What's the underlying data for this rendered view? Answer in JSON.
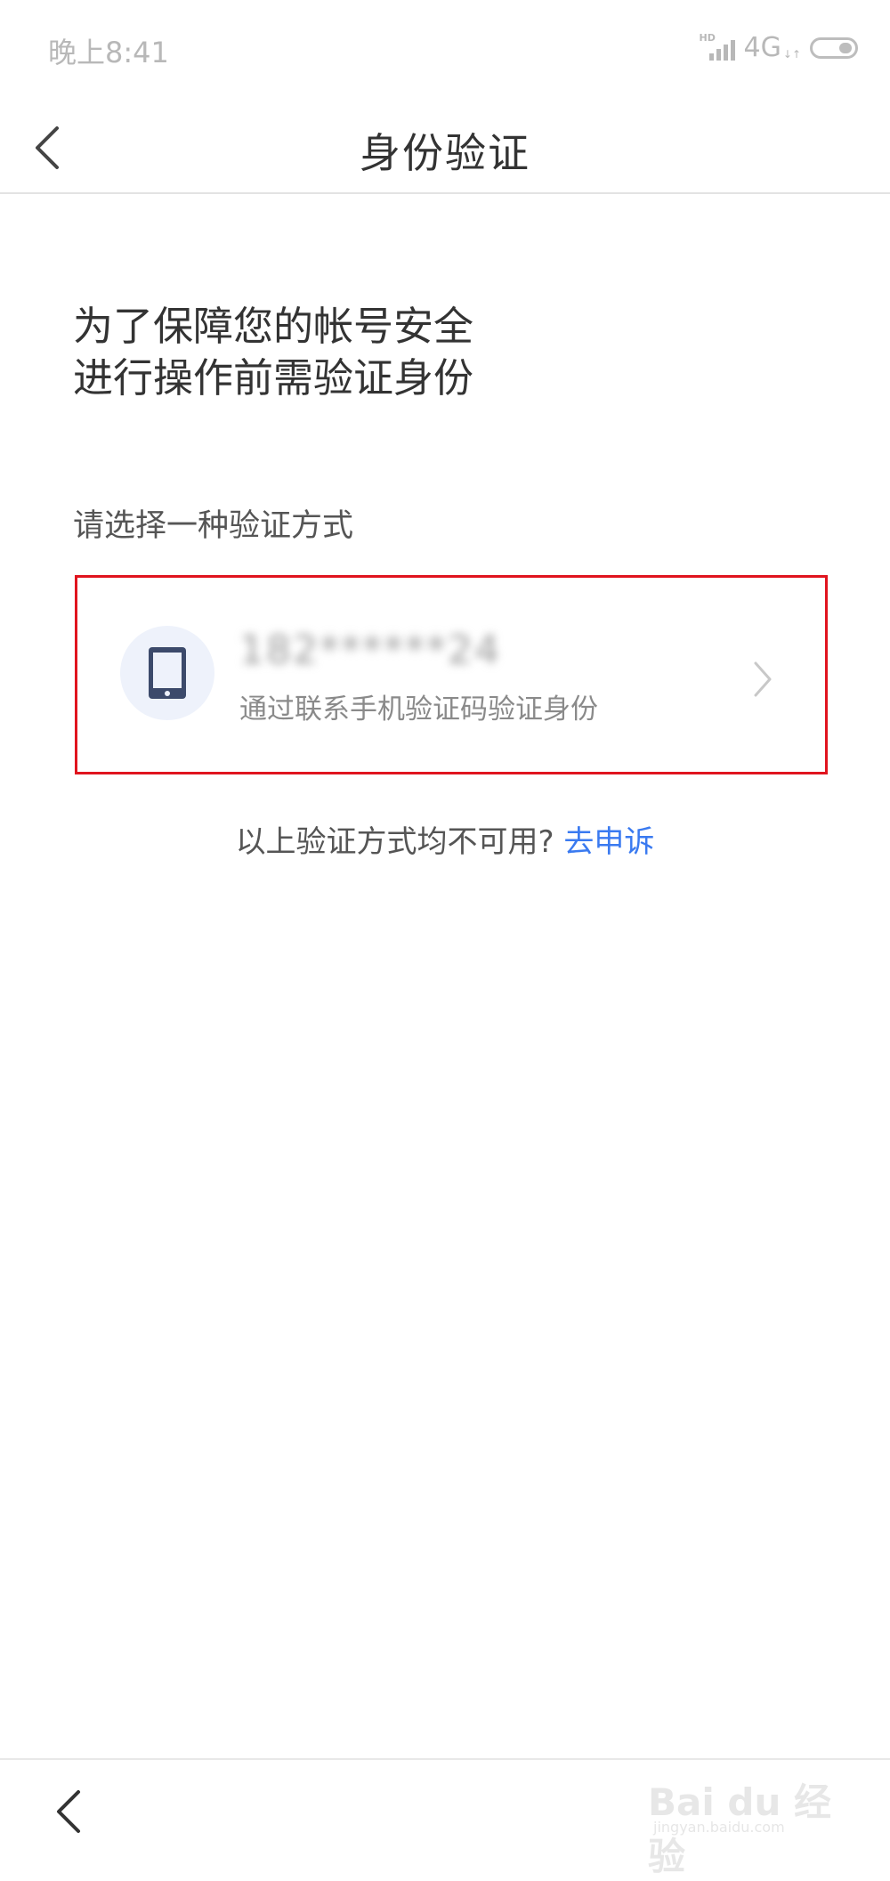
{
  "status_bar": {
    "time": "晚上8:41",
    "hd": "HD",
    "network": "4G",
    "network_arrows": "↓↑"
  },
  "nav": {
    "title": "身份验证"
  },
  "intro": {
    "line1": "为了保障您的帐号安全",
    "line2": "进行操作前需验证身份"
  },
  "choose_label": "请选择一种验证方式",
  "method": {
    "phone_number": "182******24",
    "description": "通过联系手机验证码验证身份",
    "icon": "phone-icon"
  },
  "appeal": {
    "question": "以上验证方式均不可用?",
    "link": "去申诉"
  },
  "watermark": {
    "text": "Bai du 经验",
    "url": "jingyan.baidu.com"
  },
  "colors": {
    "link": "#3a7af0",
    "highlight_border": "#e0141e",
    "avatar_bg": "#eef2fb",
    "icon": "#3c4a6b"
  }
}
